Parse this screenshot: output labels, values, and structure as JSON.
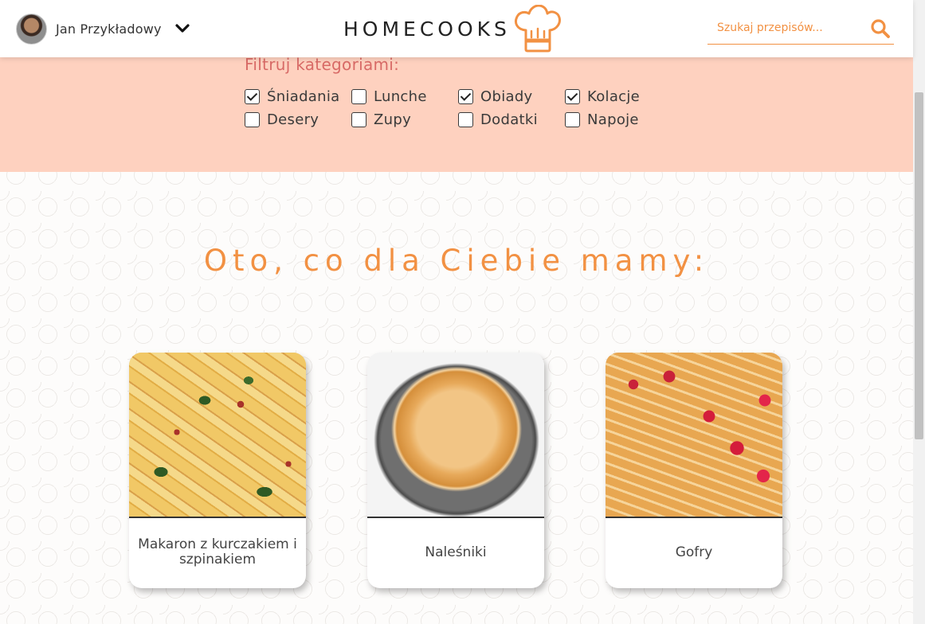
{
  "header": {
    "user_name": "Jan Przykładowy",
    "brand": "HOMECOOKS",
    "search_placeholder": "Szukaj przepisów...",
    "icons": {
      "user_menu": "chevron-down-icon",
      "brand": "chef-hat-icon",
      "search": "search-icon"
    }
  },
  "filter": {
    "title": "Filtruj kategoriami:",
    "categories": [
      {
        "label": "Śniadania",
        "checked": true
      },
      {
        "label": "Lunche",
        "checked": false
      },
      {
        "label": "Obiady",
        "checked": true
      },
      {
        "label": "Kolacje",
        "checked": true
      },
      {
        "label": "Desery",
        "checked": false
      },
      {
        "label": "Zupy",
        "checked": false
      },
      {
        "label": "Dodatki",
        "checked": false
      },
      {
        "label": "Napoje",
        "checked": false
      }
    ]
  },
  "main": {
    "heading": "Oto, co dla Ciebie mamy:",
    "recipes": [
      {
        "title": "Makaron z kurczakiem i szpinakiem"
      },
      {
        "title": "Naleśniki"
      },
      {
        "title": "Gofry"
      }
    ]
  },
  "colors": {
    "accent": "#f29143",
    "filter_bg": "#fed1bf",
    "filter_title": "#d86a66"
  }
}
